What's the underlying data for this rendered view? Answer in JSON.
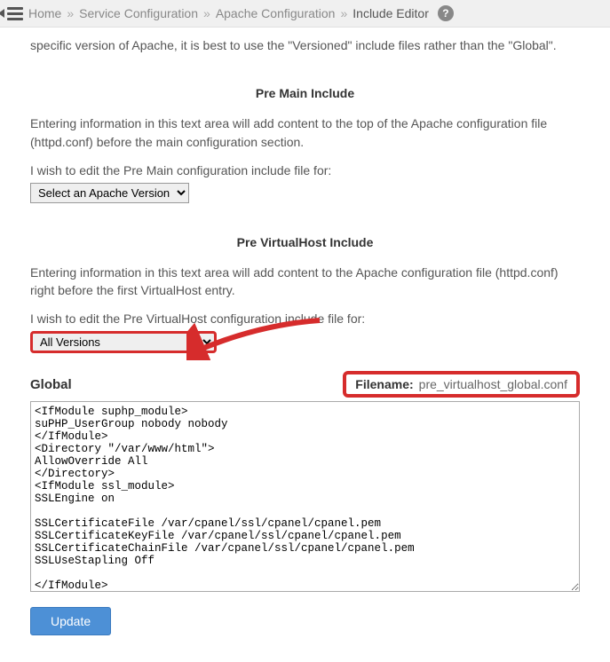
{
  "breadcrumb": {
    "items": [
      "Home",
      "Service Configuration",
      "Apache Configuration"
    ],
    "current": "Include Editor"
  },
  "intro": "specific version of Apache, it is best to use the \"Versioned\" include files rather than the \"Global\".",
  "sections": {
    "premain": {
      "title": "Pre Main Include",
      "desc": "Entering information in this text area will add content to the top of the Apache configuration file (httpd.conf) before the main configuration section.",
      "label": "I wish to edit the Pre Main configuration include file for:",
      "select_value": "Select an Apache Version"
    },
    "prevhost": {
      "title": "Pre VirtualHost Include",
      "desc": "Entering information in this text area will add content to the Apache configuration file (httpd.conf) right before the first VirtualHost entry.",
      "label": "I wish to edit the Pre VirtualHost configuration include file for:",
      "select_value": "All Versions",
      "file_heading": "Global",
      "filename_label": "Filename:",
      "filename_value": "pre_virtualhost_global.conf",
      "textarea_value": "<IfModule suphp_module>\nsuPHP_UserGroup nobody nobody\n</IfModule>\n<Directory \"/var/www/html\">\nAllowOverride All\n</Directory>\n<IfModule ssl_module>\nSSLEngine on\n\nSSLCertificateFile /var/cpanel/ssl/cpanel/cpanel.pem\nSSLCertificateKeyFile /var/cpanel/ssl/cpanel/cpanel.pem\nSSLCertificateChainFile /var/cpanel/ssl/cpanel/cpanel.pem\nSSLUseStapling Off\n\n</IfModule>",
      "update_label": "Update"
    }
  }
}
